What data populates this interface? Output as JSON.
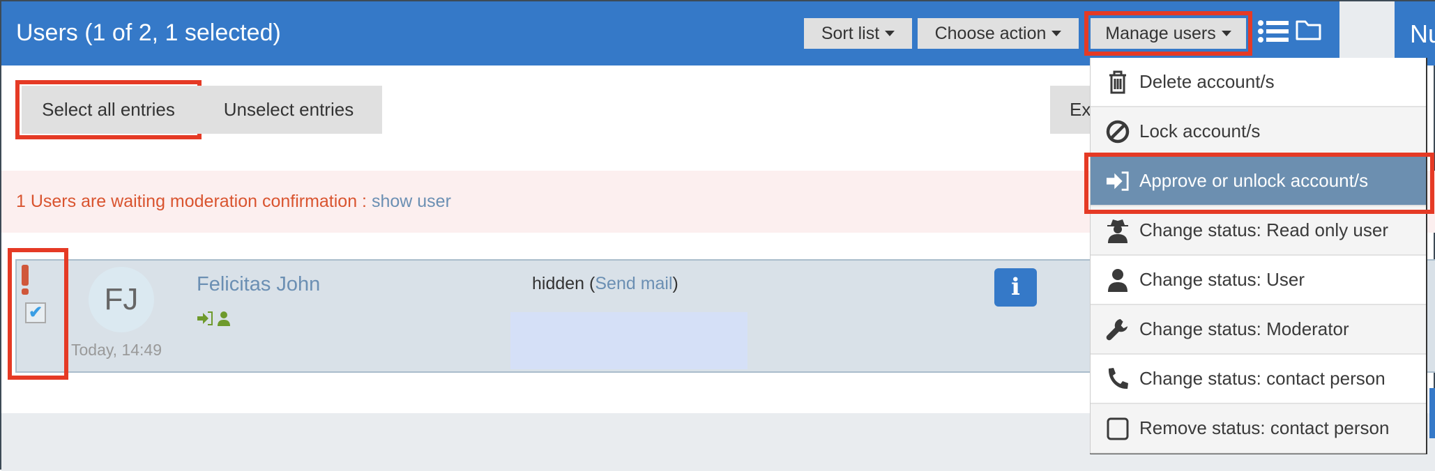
{
  "header": {
    "title": "Users (1 of 2, 1 selected)",
    "sort_label": "Sort list",
    "action_label": "Choose action",
    "manage_label": "Manage users",
    "right_text": "Nu"
  },
  "toolbar": {
    "select_all": "Select all entries",
    "unselect": "Unselect entries",
    "export_partial": "Ex"
  },
  "banner": {
    "message": "1 Users are waiting moderation confirmation : ",
    "link": "show user"
  },
  "user": {
    "initials": "FJ",
    "name": "Felicitas John",
    "time": "Today, 14:49",
    "email": "hidden",
    "email_open": " (",
    "email_link": "Send mail",
    "email_close": ")",
    "checked": true
  },
  "menu": {
    "items": [
      {
        "label": "Delete account/s",
        "icon": "trash-icon"
      },
      {
        "label": "Lock account/s",
        "icon": "ban-icon"
      },
      {
        "label": "Approve or unlock account/s",
        "icon": "sign-in-icon",
        "selected": true
      },
      {
        "label": "Change status: Read only user",
        "icon": "user-secret-icon"
      },
      {
        "label": "Change status: User",
        "icon": "user-icon"
      },
      {
        "label": "Change status: Moderator",
        "icon": "wrench-icon"
      },
      {
        "label": "Change status: contact person",
        "icon": "phone-icon"
      },
      {
        "label": "Remove status: contact person",
        "icon": "square-icon"
      }
    ]
  },
  "colors": {
    "header": "#3579c8",
    "highlight": "#6c8fb0",
    "annotation": "#e53a25",
    "warning": "#d9542f",
    "status_green": "#6e9a2c"
  }
}
